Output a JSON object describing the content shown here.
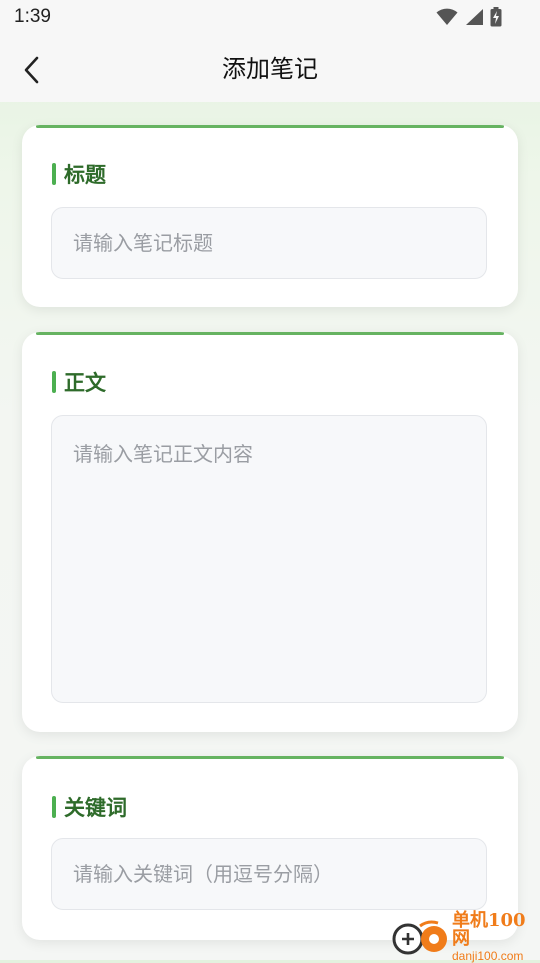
{
  "status_bar": {
    "time": "1:39",
    "icons": [
      "wifi-icon",
      "cell-signal-icon",
      "battery-charging-icon"
    ]
  },
  "app_bar": {
    "back_icon": "chevron-left-icon",
    "title": "添加笔记"
  },
  "form": {
    "title_section": {
      "label": "标题",
      "placeholder": "请输入笔记标题",
      "value": ""
    },
    "body_section": {
      "label": "正文",
      "placeholder": "请输入笔记正文内容",
      "value": ""
    },
    "keywords_section": {
      "label": "关键词",
      "placeholder": "请输入关键词（用逗号分隔）",
      "value": ""
    }
  },
  "watermark": {
    "name": "单机100网",
    "url": "danji100.com"
  },
  "colors": {
    "accent_green": "#4caf50",
    "label_green": "#2e6b2a",
    "watermark_orange": "#f07c1a"
  }
}
